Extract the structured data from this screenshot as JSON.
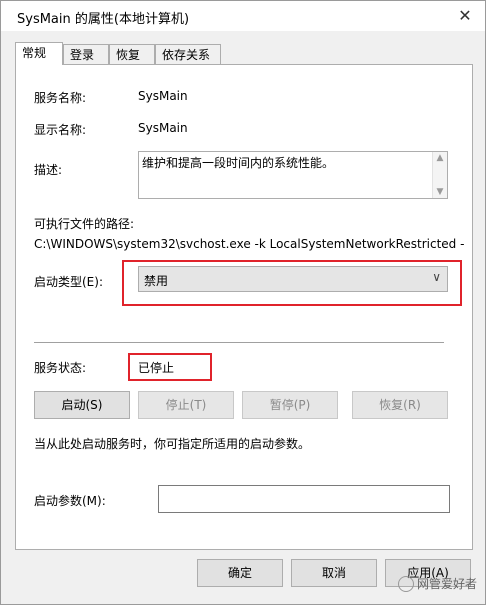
{
  "window": {
    "title": "SysMain 的属性(本地计算机)"
  },
  "tabs": [
    {
      "label": "常规"
    },
    {
      "label": "登录"
    },
    {
      "label": "恢复"
    },
    {
      "label": "依存关系"
    }
  ],
  "general": {
    "service_name_label": "服务名称:",
    "service_name_value": "SysMain",
    "display_name_label": "显示名称:",
    "display_name_value": "SysMain",
    "description_label": "描述:",
    "description_value": "维护和提高一段时间内的系统性能。",
    "exe_path_label": "可执行文件的路径:",
    "exe_path_value": "C:\\WINDOWS\\system32\\svchost.exe -k LocalSystemNetworkRestricted -",
    "startup_type_label": "启动类型(E):",
    "startup_type_value": "禁用",
    "status_label": "服务状态:",
    "status_value": "已停止",
    "buttons": {
      "start": "启动(S)",
      "stop": "停止(T)",
      "pause": "暂停(P)",
      "resume": "恢复(R)"
    },
    "hint": "当从此处启动服务时，你可指定所适用的启动参数。",
    "params_label": "启动参数(M):",
    "params_value": ""
  },
  "footer": {
    "ok": "确定",
    "cancel": "取消",
    "apply": "应用(A)"
  },
  "watermark": "网管爱好者",
  "highlight_color": "#e0232b"
}
